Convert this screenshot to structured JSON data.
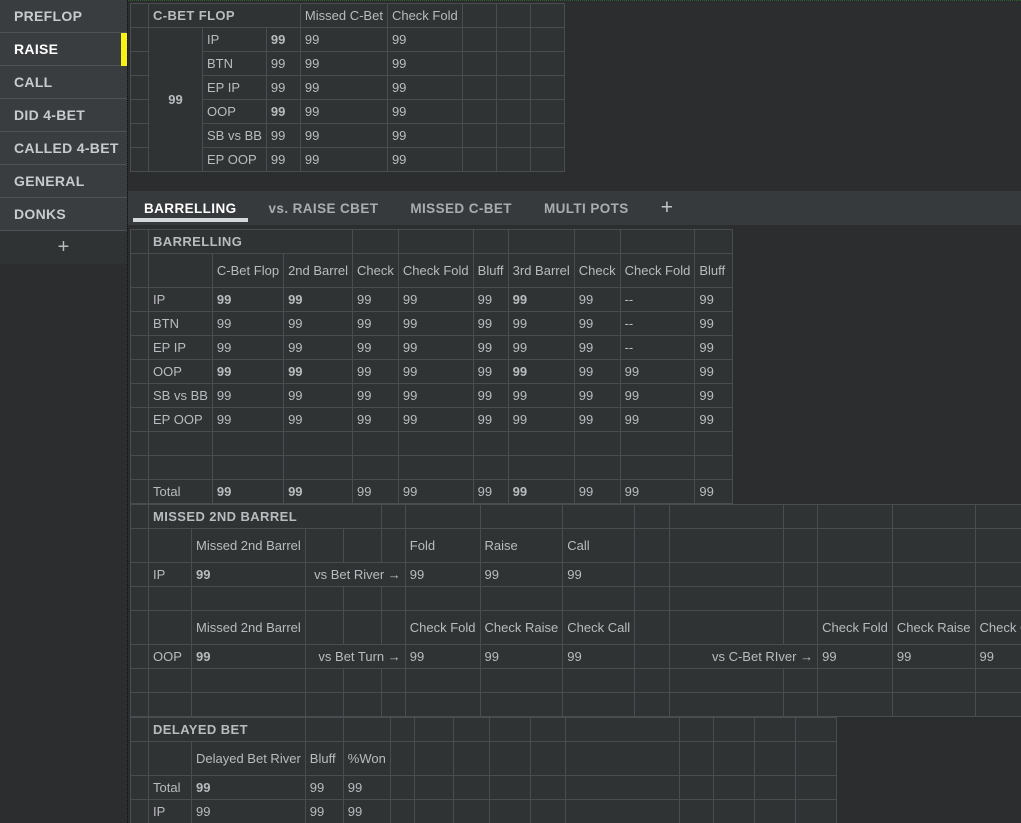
{
  "sidebar": {
    "items": [
      {
        "label": "PREFLOP",
        "active": false
      },
      {
        "label": "RAISE",
        "active": true
      },
      {
        "label": "CALL",
        "active": false
      },
      {
        "label": "DID 4-BET",
        "active": false
      },
      {
        "label": "CALLED 4-BET",
        "active": false
      },
      {
        "label": "GENERAL",
        "active": false
      },
      {
        "label": "DONKS",
        "active": false
      }
    ],
    "add_label": "+",
    "accent_color": "#f6f315"
  },
  "tabs": {
    "items": [
      {
        "label": "BARRELLING",
        "active": true
      },
      {
        "label": "vs. RAISE CBET",
        "active": false
      },
      {
        "label": "MISSED C-BET",
        "active": false
      },
      {
        "label": "MULTI POTS",
        "active": false
      }
    ],
    "add_label": "+"
  },
  "cbet_flop": {
    "title": "C-BET FLOP",
    "aggregate": "99",
    "columns": [
      "",
      "Missed\nC-Bet",
      "Check\nFold",
      "",
      "",
      ""
    ],
    "col_headers": {
      "c1": "",
      "missed_cbet": "Missed C-Bet",
      "check_fold": "Check Fold"
    },
    "rows": [
      {
        "label": "IP",
        "values": [
          "99",
          "99",
          "99"
        ],
        "emphasis": [
          "strong",
          "norm",
          "norm"
        ]
      },
      {
        "label": "BTN",
        "values": [
          "99",
          "99",
          "99"
        ],
        "emphasis": [
          "norm",
          "norm",
          "norm"
        ]
      },
      {
        "label": "EP IP",
        "values": [
          "99",
          "99",
          "99"
        ],
        "emphasis": [
          "norm",
          "norm",
          "norm"
        ]
      },
      {
        "label": "OOP",
        "values": [
          "99",
          "99",
          "99"
        ],
        "emphasis": [
          "strong",
          "norm",
          "norm"
        ]
      },
      {
        "label": "SB vs BB",
        "values": [
          "99",
          "99",
          "99"
        ],
        "emphasis": [
          "norm",
          "norm",
          "norm"
        ]
      },
      {
        "label": "EP OOP",
        "values": [
          "99",
          "99",
          "99"
        ],
        "emphasis": [
          "norm",
          "norm",
          "norm"
        ]
      }
    ]
  },
  "barrelling": {
    "title": "BARRELLING",
    "headers": [
      "C-Bet Flop",
      "2nd Barrel",
      "Check",
      "Check Fold",
      "Bluff",
      "3rd Barrel",
      "Check",
      "Check Fold",
      "Bluff"
    ],
    "rows": [
      {
        "label": "IP",
        "values": [
          "99",
          "99",
          "99",
          "99",
          "99",
          "99",
          "99",
          "--",
          "99"
        ],
        "emphasis": [
          "strong",
          "strong",
          "norm",
          "norm",
          "dim",
          "strong",
          "norm",
          "norm",
          "dim"
        ]
      },
      {
        "label": "BTN",
        "values": [
          "99",
          "99",
          "99",
          "99",
          "99",
          "99",
          "99",
          "--",
          "99"
        ],
        "emphasis": [
          "norm",
          "norm",
          "norm",
          "norm",
          "dim",
          "norm",
          "norm",
          "norm",
          "dim"
        ]
      },
      {
        "label": "EP IP",
        "values": [
          "99",
          "99",
          "99",
          "99",
          "99",
          "99",
          "99",
          "--",
          "99"
        ],
        "emphasis": [
          "norm",
          "norm",
          "norm",
          "norm",
          "dim",
          "norm",
          "norm",
          "norm",
          "dim"
        ]
      },
      {
        "label": "OOP",
        "values": [
          "99",
          "99",
          "99",
          "99",
          "99",
          "99",
          "99",
          "99",
          "99"
        ],
        "emphasis": [
          "strong",
          "strong",
          "norm",
          "norm",
          "dim",
          "strong",
          "norm",
          "norm",
          "dim"
        ]
      },
      {
        "label": "SB vs BB",
        "values": [
          "99",
          "99",
          "99",
          "99",
          "99",
          "99",
          "99",
          "99",
          "99"
        ],
        "emphasis": [
          "dim",
          "dim",
          "norm",
          "norm",
          "dim",
          "norm",
          "norm",
          "norm",
          "dim"
        ]
      },
      {
        "label": "EP OOP",
        "values": [
          "99",
          "99",
          "99",
          "99",
          "99",
          "99",
          "99",
          "99",
          "99"
        ],
        "emphasis": [
          "dim",
          "dim",
          "norm",
          "norm",
          "dim",
          "norm",
          "norm",
          "norm",
          "dim"
        ]
      },
      {
        "label": "",
        "values": [
          "",
          "",
          "",
          "",
          "",
          "",
          "",
          "",
          ""
        ],
        "emphasis": [
          "norm",
          "norm",
          "norm",
          "norm",
          "norm",
          "norm",
          "norm",
          "norm",
          "norm"
        ]
      },
      {
        "label": "",
        "values": [
          "",
          "",
          "",
          "",
          "",
          "",
          "",
          "",
          ""
        ],
        "emphasis": [
          "norm",
          "norm",
          "norm",
          "norm",
          "norm",
          "norm",
          "norm",
          "norm",
          "norm"
        ]
      },
      {
        "label": "Total",
        "values": [
          "99",
          "99",
          "99",
          "99",
          "99",
          "99",
          "99",
          "99",
          "99"
        ],
        "emphasis": [
          "strong",
          "strong",
          "norm",
          "norm",
          "dim",
          "strong",
          "norm",
          "norm",
          "dim"
        ]
      }
    ]
  },
  "missed_2nd_barrel": {
    "title": "MISSED 2ND BARREL",
    "block_ip": {
      "col_label": "Missed 2nd Barrel",
      "headers": [
        "Fold",
        "Raise",
        "Call"
      ],
      "row_label": "IP",
      "value": "99",
      "arrow_label": "vs Bet River →",
      "values": [
        "99",
        "99",
        "99"
      ]
    },
    "block_oop": {
      "col_label": "Missed 2nd Barrel",
      "headers": [
        "Check Fold",
        "Check Raise",
        "Check Call"
      ],
      "headers2": [
        "Check Fold",
        "Check Raise",
        "Check Call"
      ],
      "row_label": "OOP",
      "value": "99",
      "arrow_label": "vs Bet Turn →",
      "values": [
        "99",
        "99",
        "99"
      ],
      "arrow_label2": "vs C-Bet RIver →",
      "values2": [
        "99",
        "99",
        "99"
      ]
    }
  },
  "delayed_bet": {
    "title": "DELAYED BET",
    "headers": [
      "Delayed Bet River",
      "Bluff",
      "%Won"
    ],
    "rows": [
      {
        "label": "Total",
        "values": [
          "99",
          "99",
          "99"
        ],
        "emphasis": [
          "strong",
          "dim",
          "dim"
        ]
      },
      {
        "label": "IP",
        "values": [
          "99",
          "99",
          "99"
        ],
        "emphasis": [
          "dim",
          "dim",
          "dim"
        ]
      }
    ]
  }
}
